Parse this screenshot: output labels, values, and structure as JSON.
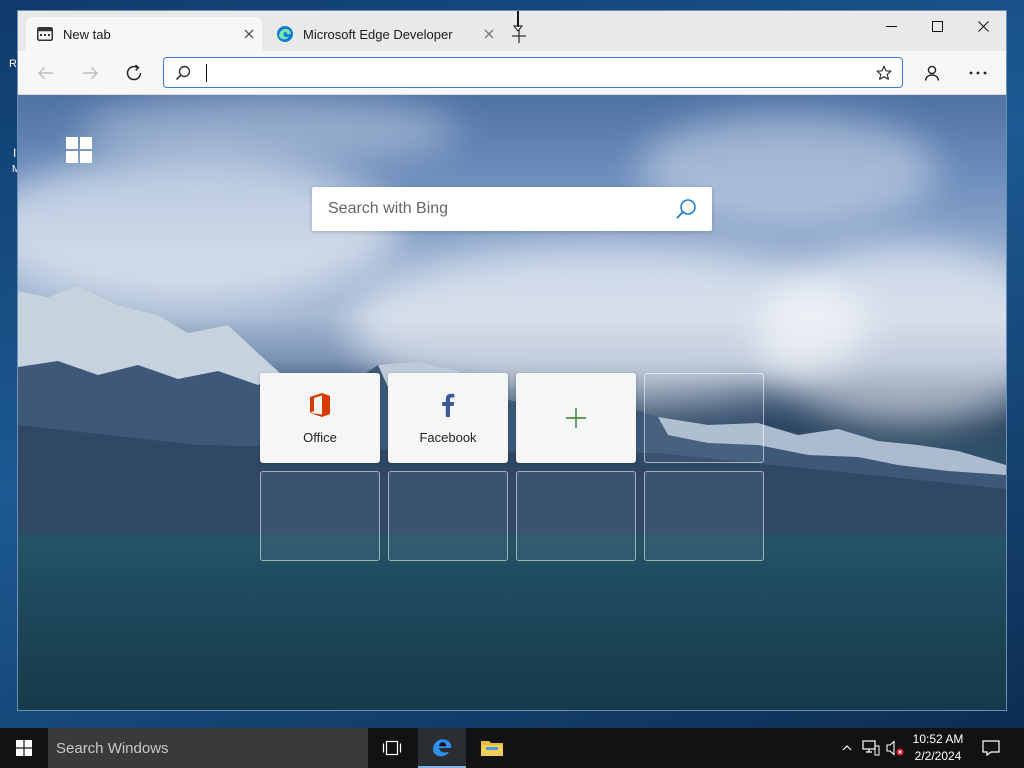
{
  "desktop": {
    "peek_letters": [
      "R",
      "I",
      "M"
    ]
  },
  "browser": {
    "tabs": [
      {
        "title": "New tab",
        "icon": "newtab-page-icon",
        "active": true
      },
      {
        "title": "Microsoft Edge Developer",
        "icon": "edge-logo-icon",
        "active": false
      }
    ],
    "new_tab_symbol": "+",
    "address_bar": {
      "value": "",
      "placeholder": ""
    }
  },
  "new_tab_page": {
    "search": {
      "placeholder": "Search with Bing"
    },
    "quick_links": [
      {
        "label": "Office",
        "icon": "office-icon",
        "icon_color": "#d83b01"
      },
      {
        "label": "Facebook",
        "icon": "facebook-icon",
        "icon_color": "#3b5998"
      },
      {
        "label": "",
        "icon": "add-icon",
        "icon_color": "#2e7d32"
      }
    ]
  },
  "taskbar": {
    "search_placeholder": "Search Windows",
    "pinned": [
      "task-view-icon",
      "edge-icon",
      "file-explorer-icon"
    ],
    "clock": {
      "time": "10:52 AM",
      "date": "2/2/2024"
    }
  },
  "colors": {
    "accent": "#3d7ad6",
    "taskbar": "#101214",
    "edge_blue": "#0f7bd6"
  }
}
